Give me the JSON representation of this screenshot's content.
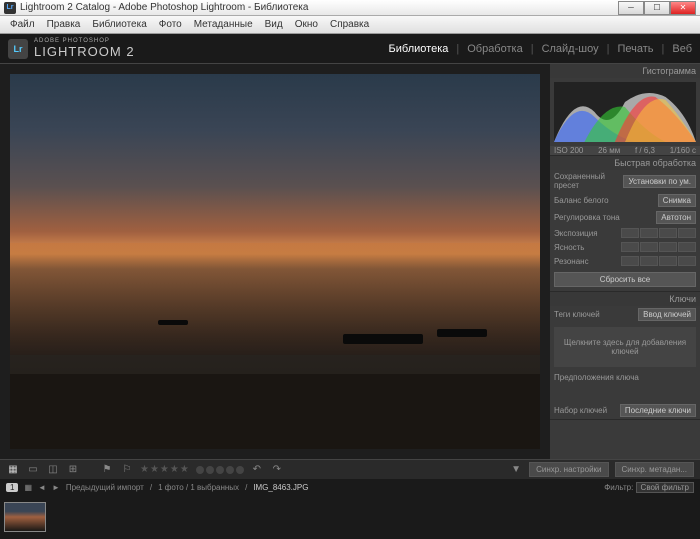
{
  "titlebar": {
    "title": "Lightroom 2 Catalog - Adobe Photoshop Lightroom - Библиотека"
  },
  "menu": {
    "items": [
      "Файл",
      "Правка",
      "Библиотека",
      "Фото",
      "Метаданные",
      "Вид",
      "Окно",
      "Справка"
    ]
  },
  "header": {
    "logo": "Lr",
    "subtitle": "ADOBE PHOTOSHOP",
    "title": "LIGHTROOM 2"
  },
  "modules": {
    "items": [
      "Библиотека",
      "Обработка",
      "Слайд-шоу",
      "Печать",
      "Веб"
    ],
    "active": 0
  },
  "histogram": {
    "title": "Гистограмма",
    "iso": "ISO 200",
    "focal": "26 мм",
    "aperture": "f / 6,3",
    "shutter": "1/160 с"
  },
  "quickdev": {
    "title": "Быстрая обработка",
    "preset_label": "Сохраненный пресет",
    "preset_value": "Установки по ум.",
    "wb_label": "Баланс белого",
    "wb_value": "Снимка",
    "tone_label": "Регулировка тона",
    "tone_btn": "Автотон",
    "exposure": "Экспозиция",
    "clarity": "Ясность",
    "vibrance": "Резонанс",
    "reset": "Сбросить все"
  },
  "keywords": {
    "title": "Ключи",
    "tags_label": "Теги ключей",
    "tags_btn": "Ввод ключей",
    "placeholder": "Щелкните здесь для добавления ключей",
    "suggest": "Предположения ключа",
    "set_label": "Набор ключей",
    "set_value": "Последние ключи"
  },
  "toolbar": {
    "sync_settings": "Синхр. настройки",
    "sync_meta": "Синхр. метадан..."
  },
  "filmstrip": {
    "count": "1",
    "grid_icon": "▦",
    "breadcrumb_prev": "Предыдущий импорт",
    "breadcrumb_count": "1 фото / 1 выбранных",
    "filename": "IMG_8463.JPG",
    "filter_label": "Фильтр:",
    "filter_value": "Свой фильтр"
  }
}
